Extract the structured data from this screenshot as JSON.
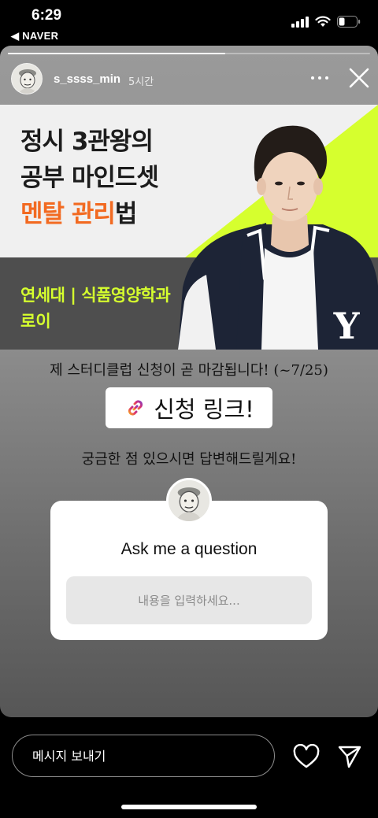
{
  "status_bar": {
    "time": "6:29",
    "back_app": "◀ NAVER",
    "icons": [
      "cellular-signal-icon",
      "wifi-icon",
      "battery-icon"
    ]
  },
  "story": {
    "progress": 0.6,
    "username": "s_ssss_min",
    "time_ago": "5시간",
    "banner": {
      "title_line1": "정시 3관왕의",
      "title_line2": "공부 마인드셋",
      "title_line3_accent": "멘탈 관리",
      "title_line3_rest": "법",
      "school": "연세대 | 식품영양학과",
      "name": "로이",
      "jacket_letter": "Y",
      "colors": {
        "accent_orange": "#f26a21",
        "lime": "#d6ff2e",
        "navy": "#1d2436"
      }
    },
    "caption1": "제 스터디클럽 신청이 곧 마감됩니다! (~7/25)",
    "link_sticker_label": "신청 링크!",
    "caption2": "궁금한 점 있으시면 답변해드릴게요!",
    "question_box": {
      "title": "Ask me a question",
      "placeholder": "내용을 입력하세요..."
    }
  },
  "bottom_bar": {
    "message_placeholder": "메시지 보내기",
    "icons": [
      "heart-icon",
      "send-icon"
    ]
  }
}
